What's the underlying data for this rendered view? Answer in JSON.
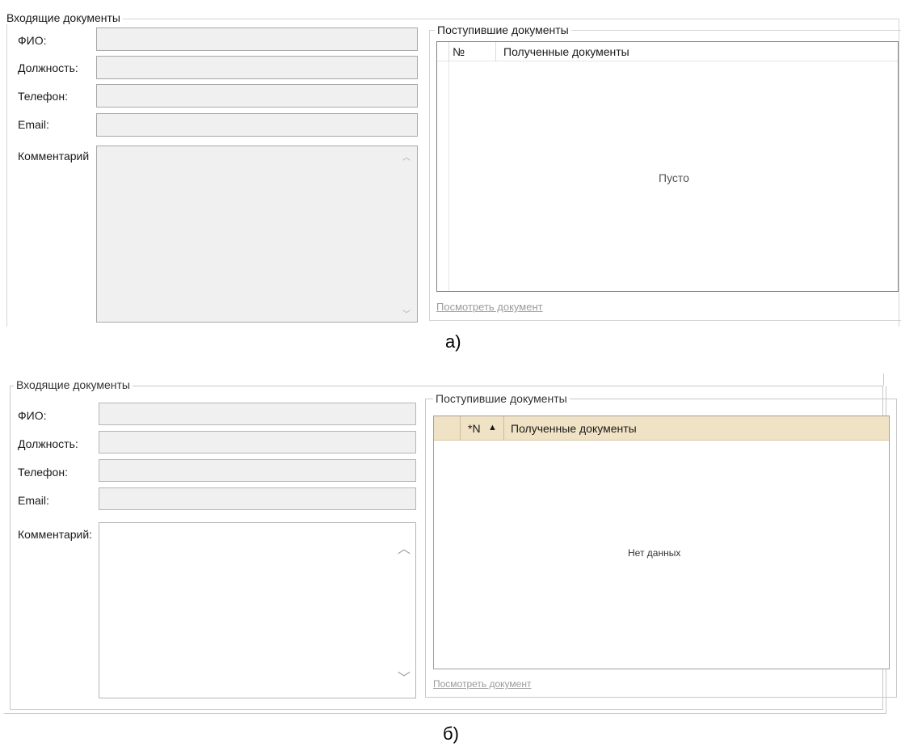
{
  "panel_a": {
    "group_title": "Входящие документы",
    "labels": {
      "fio": "ФИО:",
      "position": "Должность:",
      "phone": "Телефон:",
      "email": "Email:",
      "comment": "Комментарий"
    },
    "docs_group_title": "Поступившие документы",
    "columns": [
      "№",
      "Полученные документы"
    ],
    "empty_text": "Пусто",
    "view_link": "Посмотреть документ"
  },
  "caption_a": "а)",
  "panel_b": {
    "group_title": "Входящие документы",
    "labels": {
      "fio": "ФИО:",
      "position": "Должность:",
      "phone": "Телефон:",
      "email": "Email:",
      "comment": "Комментарий:"
    },
    "docs_group_title": "Поступившие документы",
    "columns": [
      "*N",
      "Полученные документы"
    ],
    "sort_indicator": "▲",
    "empty_text": "Нет данных",
    "view_link": "Посмотреть документ"
  },
  "caption_b": "б)",
  "colors": {
    "header_b": "#f0e2c5",
    "field_bg": "#f0f0f0",
    "link": "#9b9b9b"
  }
}
